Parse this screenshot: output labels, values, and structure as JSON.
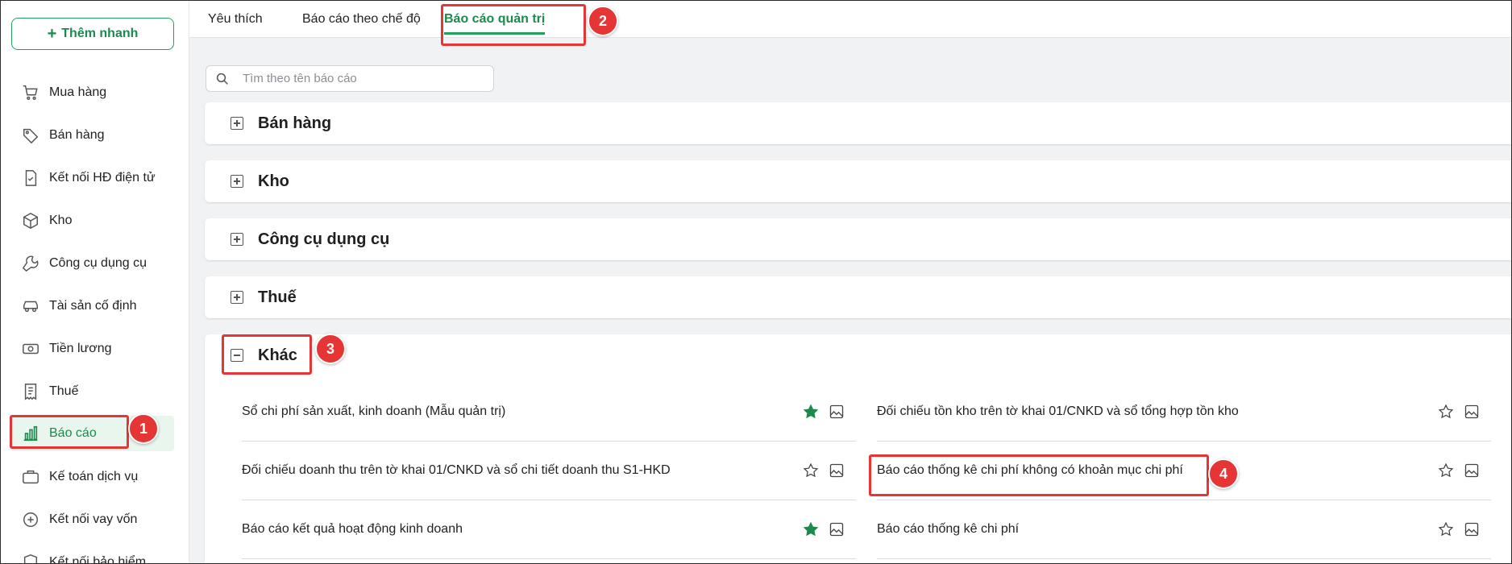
{
  "sidebar": {
    "quick_add_label": "Thêm nhanh",
    "items": [
      {
        "label": "Mua hàng",
        "icon": "cart-icon"
      },
      {
        "label": "Bán hàng",
        "icon": "tag-icon"
      },
      {
        "label": "Kết nối HĐ điện tử",
        "icon": "e-invoice-icon"
      },
      {
        "label": "Kho",
        "icon": "box-icon"
      },
      {
        "label": "Công cụ dụng cụ",
        "icon": "wrench-icon"
      },
      {
        "label": "Tài sản cố định",
        "icon": "car-icon"
      },
      {
        "label": "Tiền lương",
        "icon": "cash-icon"
      },
      {
        "label": "Thuế",
        "icon": "receipt-icon"
      },
      {
        "label": "Báo cáo",
        "icon": "bar-chart-icon",
        "active": true
      },
      {
        "label": "Kế toán dịch vụ",
        "icon": "briefcase-icon"
      },
      {
        "label": "Kết nối vay vốn",
        "icon": "loan-icon"
      },
      {
        "label": "Kết nối bảo hiểm",
        "icon": "shield-icon"
      }
    ]
  },
  "tabs": [
    {
      "label": "Yêu thích"
    },
    {
      "label": "Báo cáo theo chế độ"
    },
    {
      "label": "Báo cáo quản trị",
      "active": true
    }
  ],
  "search": {
    "placeholder": "Tìm theo tên báo cáo"
  },
  "sections": [
    {
      "title": "Bán hàng",
      "expanded": false
    },
    {
      "title": "Kho",
      "expanded": false
    },
    {
      "title": "Công cụ dụng cụ",
      "expanded": false
    },
    {
      "title": "Thuế",
      "expanded": false
    },
    {
      "title": "Khác",
      "expanded": true
    }
  ],
  "reports": [
    {
      "label": "Sổ chi phí sản xuất, kinh doanh (Mẫu quản trị)",
      "favorite": true
    },
    {
      "label": "Đối chiếu tồn kho trên tờ khai 01/CNKD và sổ tổng hợp tồn kho",
      "favorite": false
    },
    {
      "label": "Đối chiếu doanh thu trên tờ khai 01/CNKD và sổ chi tiết doanh thu S1-HKD",
      "favorite": false
    },
    {
      "label": "Báo cáo thống kê chi phí không có khoản mục chi phí",
      "favorite": false
    },
    {
      "label": "Báo cáo kết quả hoạt động kinh doanh",
      "favorite": true
    },
    {
      "label": "Báo cáo thống kê chi phí",
      "favorite": false
    }
  ],
  "annotations": [
    "1",
    "2",
    "3",
    "4"
  ],
  "colors": {
    "accent": "#22a05b",
    "highlight": "#e53535",
    "star_filled": "#1c8a4d"
  }
}
